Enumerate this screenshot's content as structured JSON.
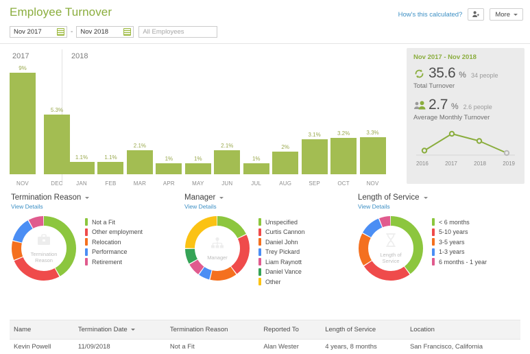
{
  "header": {
    "title": "Employee Turnover",
    "how_link": "How's this calculated?",
    "add_person_icon": "person-add-icon",
    "more_label": "More"
  },
  "filters": {
    "start_date": "Nov 2017",
    "separator": "-",
    "end_date": "Nov 2018",
    "employee_placeholder": "All Employees",
    "calendar_icon": "calendar-icon"
  },
  "chart_data": {
    "type": "bar",
    "title": "",
    "xlabel": "",
    "ylabel": "",
    "ylim": [
      0,
      9
    ],
    "groups": [
      {
        "year": "2017",
        "categories": [
          "NOV",
          "DEC"
        ],
        "values": [
          9,
          5.3
        ],
        "labels": [
          "9%",
          "5.3%"
        ]
      },
      {
        "year": "2018",
        "categories": [
          "JAN",
          "FEB",
          "MAR",
          "APR",
          "MAY",
          "JUN",
          "JUL",
          "AUG",
          "SEP",
          "OCT",
          "NOV"
        ],
        "values": [
          1.1,
          1.1,
          2.1,
          1,
          1,
          2.1,
          1,
          2,
          3.1,
          3.2,
          3.3
        ],
        "labels": [
          "1.1%",
          "1.1%",
          "2.1%",
          "1%",
          "1%",
          "2.1%",
          "1%",
          "2%",
          "3.1%",
          "3.2%",
          "3.3%"
        ]
      }
    ],
    "bar_color": "#a3bd52",
    "grid": false
  },
  "summary": {
    "range": "Nov 2017 - Nov 2018",
    "total": {
      "icon": "refresh-cycle-icon",
      "value": "35.6",
      "unit": "%",
      "people": "34 people",
      "caption": "Total Turnover"
    },
    "average": {
      "icon": "people-icon",
      "value": "2.7",
      "unit": "%",
      "people": "2.6 people",
      "caption": "Average Monthly Turnover"
    },
    "sparkline": {
      "type": "line",
      "x": [
        "2016",
        "2017",
        "2018",
        "2019"
      ],
      "values": [
        1.8,
        3.2,
        2.6,
        1.6
      ],
      "line_color": "#8aad3d",
      "last_point_color": "#b9b9b9"
    }
  },
  "donuts": [
    {
      "title": "Termination Reason",
      "view_details": "View Details",
      "center_label": "Termination\nReason",
      "center_line1": "Termination",
      "center_line2": "Reason",
      "center_icon": "briefcase-icon",
      "type": "pie",
      "segments": [
        {
          "label": "Not a Fit",
          "value": 42,
          "color": "#8cc63e"
        },
        {
          "label": "Other employment",
          "value": 27,
          "color": "#ef4b4b"
        },
        {
          "label": "Relocation",
          "value": 10,
          "color": "#f4701f"
        },
        {
          "label": "Performance",
          "value": 13,
          "color": "#4b8ef4"
        },
        {
          "label": "Retirement",
          "value": 8,
          "color": "#e05b8e"
        }
      ]
    },
    {
      "title": "Manager",
      "view_details": "View Details",
      "center_line1": "Manager",
      "center_line2": "",
      "center_icon": "org-chart-icon",
      "type": "pie",
      "segments": [
        {
          "label": "Unspecified",
          "value": 18,
          "color": "#8cc63e"
        },
        {
          "label": "Curtis Cannon",
          "value": 22,
          "color": "#ef4b4b"
        },
        {
          "label": "Daniel John",
          "value": 14,
          "color": "#f4701f"
        },
        {
          "label": "Trey Pickard",
          "value": 6,
          "color": "#4b8ef4"
        },
        {
          "label": "Liam Raynott",
          "value": 7,
          "color": "#e05b8e"
        },
        {
          "label": "Daniel Vance",
          "value": 8,
          "color": "#35a356"
        },
        {
          "label": "Other",
          "value": 25,
          "color": "#fbc214"
        }
      ]
    },
    {
      "title": "Length of Service",
      "view_details": "View Details",
      "center_line1": "Length of",
      "center_line2": "Service",
      "center_icon": "hourglass-icon",
      "type": "pie",
      "segments": [
        {
          "label": "< 6 months",
          "value": 40,
          "color": "#8cc63e"
        },
        {
          "label": "5-10 years",
          "value": 26,
          "color": "#ef4b4b"
        },
        {
          "label": "3-5 years",
          "value": 17,
          "color": "#f4701f"
        },
        {
          "label": "1-3 years",
          "value": 11,
          "color": "#4b8ef4"
        },
        {
          "label": "6 months - 1 year",
          "value": 6,
          "color": "#e05b8e"
        }
      ]
    }
  ],
  "table": {
    "columns": [
      {
        "label": "Name",
        "sorted": false
      },
      {
        "label": "Termination Date",
        "sorted": true
      },
      {
        "label": "Termination Reason",
        "sorted": false
      },
      {
        "label": "Reported To",
        "sorted": false
      },
      {
        "label": "Length of Service",
        "sorted": false
      },
      {
        "label": "Location",
        "sorted": false
      }
    ],
    "rows": [
      {
        "name": "Kevin Powell",
        "termination_date": "11/09/2018",
        "termination_reason": "Not a Fit",
        "reported_to": "Alan Wester",
        "length_of_service": "4 years, 8 months",
        "location": "San Francisco, California"
      }
    ]
  }
}
